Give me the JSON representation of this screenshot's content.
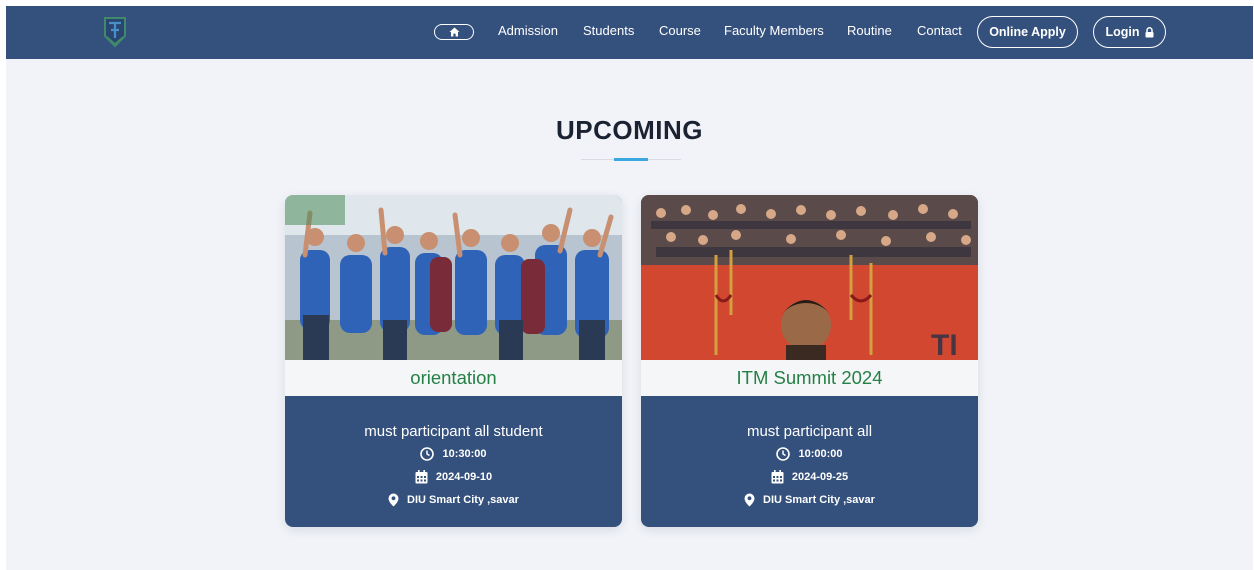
{
  "nav": {
    "links": [
      "Admission",
      "Students",
      "Course",
      "Faculty Members",
      "Routine",
      "Contact"
    ],
    "apply_label": "Online Apply",
    "login_label": "Login"
  },
  "section": {
    "title": "UPCOMING"
  },
  "events": [
    {
      "title": "orientation",
      "description": "must participant all student",
      "time": "10:30:00",
      "date": "2024-09-10",
      "location": "DIU Smart City ,savar"
    },
    {
      "title": "ITM Summit 2024",
      "description": "must participant all",
      "time": "10:00:00",
      "date": "2024-09-25",
      "location": "DIU Smart City ,savar"
    }
  ],
  "colors": {
    "navbar": "#34507c",
    "page_background": "#f1f3f8",
    "card_body": "#34507c",
    "card_title": "#258046",
    "title_accent": "#3aa7de"
  },
  "icons": [
    "home-icon",
    "lock-icon",
    "clock-icon",
    "calendar-icon",
    "location-pin-icon"
  ]
}
